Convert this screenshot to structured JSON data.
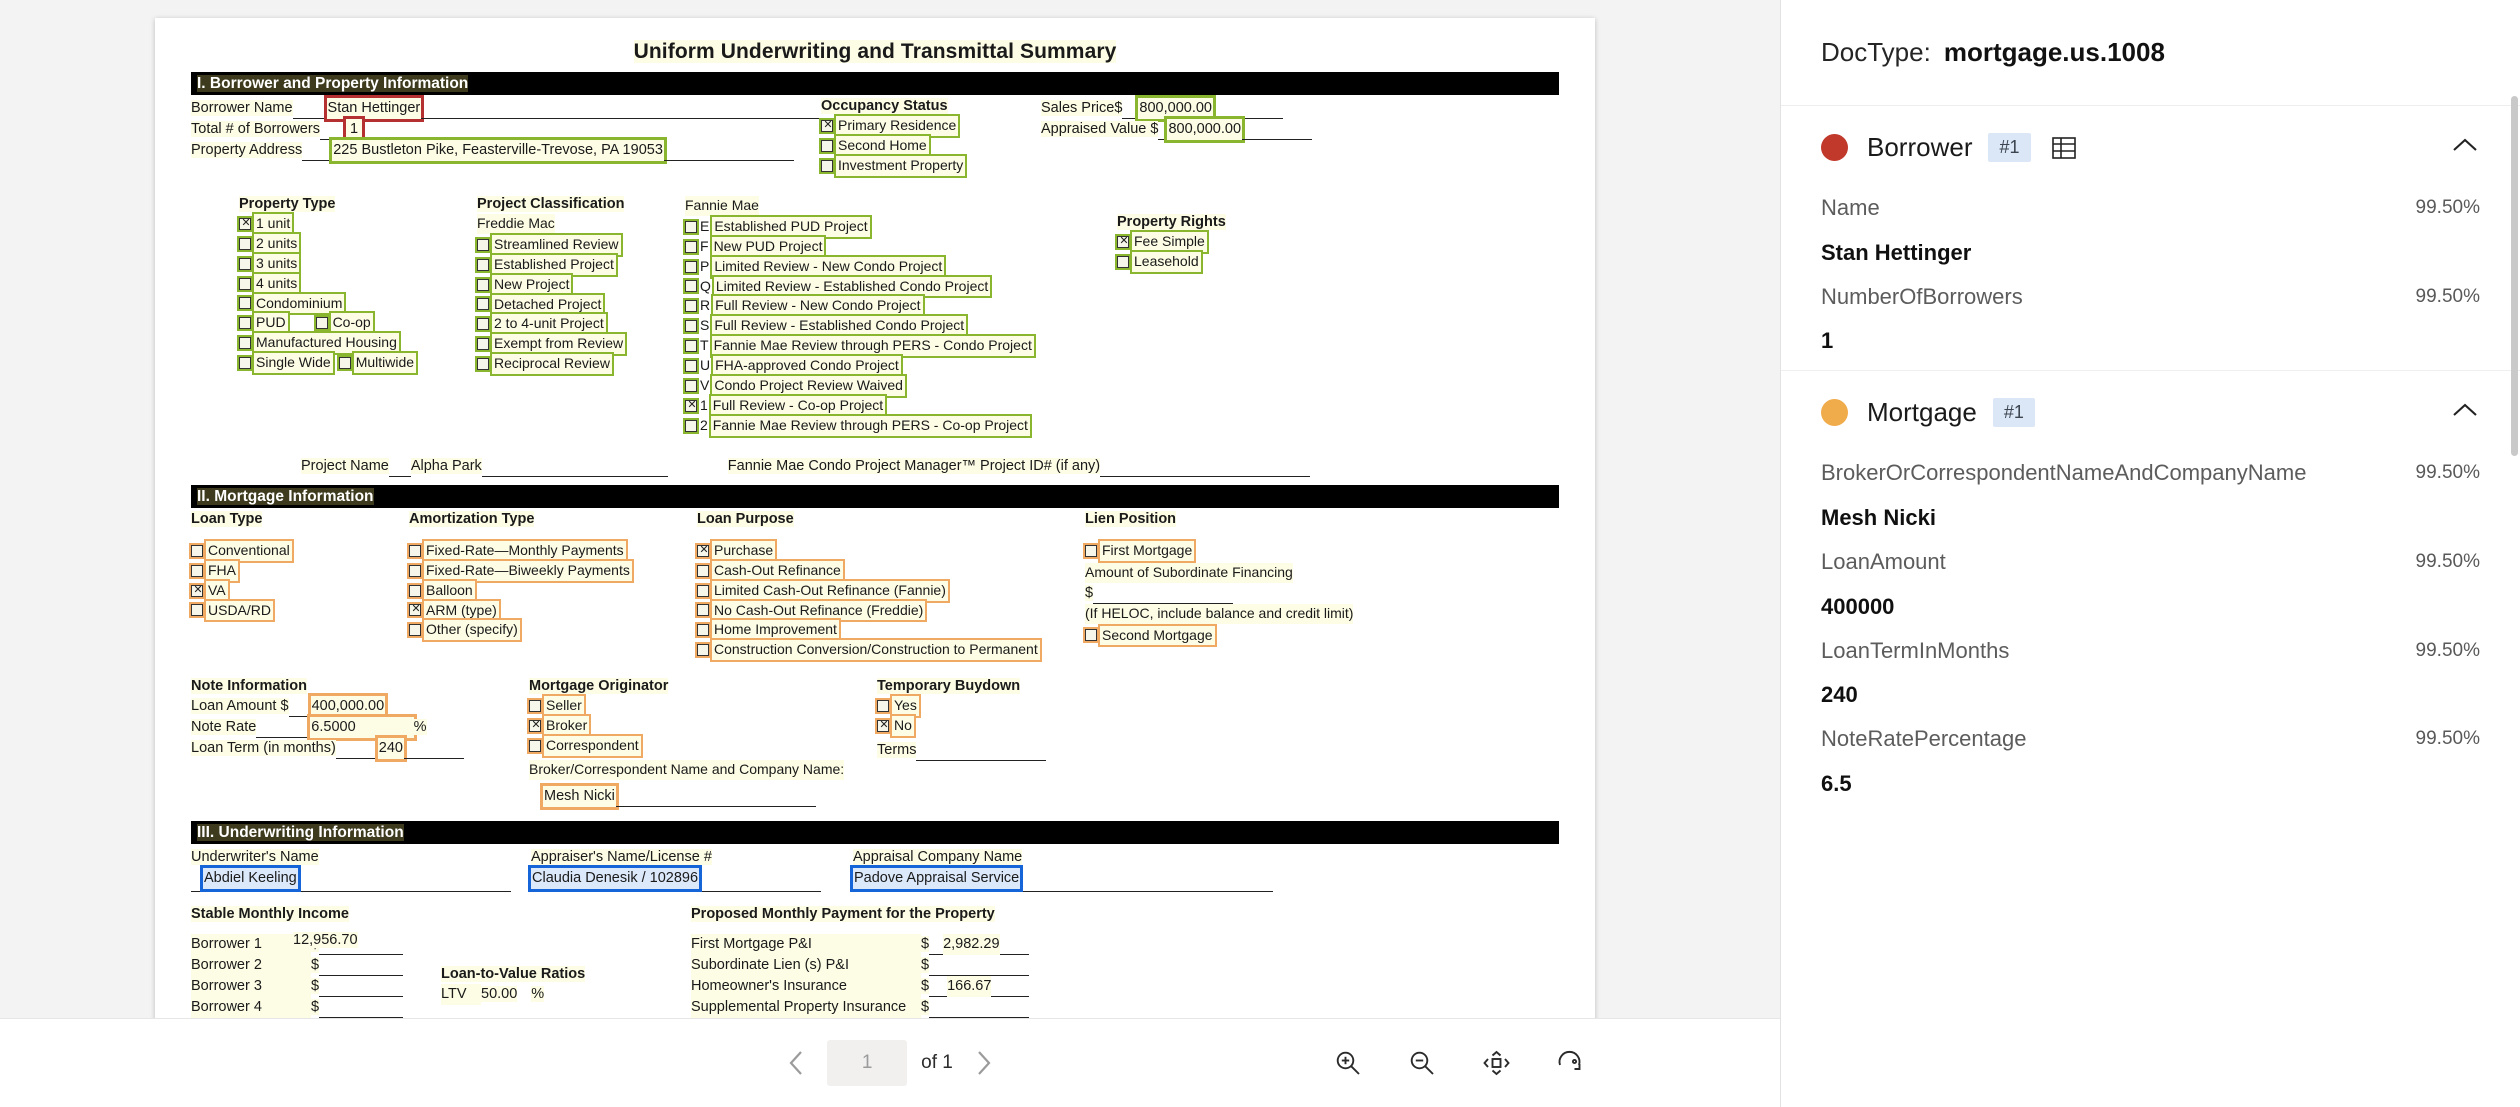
{
  "document": {
    "title": "Uniform Underwriting and Transmittal Summary",
    "section1": {
      "band": "I. Borrower and Property Information",
      "fields": [
        {
          "label": "Borrower Name",
          "value": "Stan Hettinger",
          "mark": "red"
        },
        {
          "label": "Total # of Borrowers",
          "value": "1",
          "mark": "red"
        },
        {
          "label": "Property Address",
          "value": "225 Bustleton Pike, Feasterville-Trevose, PA 19053",
          "mark": "green"
        }
      ],
      "occupancy": {
        "title": "Occupancy Status",
        "items": [
          {
            "label": "Primary Residence",
            "checked": true
          },
          {
            "label": "Second Home",
            "checked": false
          },
          {
            "label": "Investment Property",
            "checked": false
          }
        ]
      },
      "prices": [
        {
          "label": "Sales Price$",
          "value": "800,000.00"
        },
        {
          "label": "Appraised Value $",
          "value": "800,000.00"
        }
      ],
      "property_type": {
        "title": "Property Type",
        "items": [
          {
            "label": "1 unit",
            "checked": true
          },
          {
            "label": "2 units",
            "checked": false
          },
          {
            "label": "3 units",
            "checked": false
          },
          {
            "label": "4 units",
            "checked": false
          },
          {
            "label": "Condominium",
            "checked": false
          },
          {
            "label": "PUD",
            "checked": false
          },
          {
            "label": "Co-op",
            "checked": false
          },
          {
            "label": "Manufactured Housing",
            "checked": false
          },
          {
            "label": "Single Wide",
            "checked": false
          },
          {
            "label": "Multiwide",
            "checked": false
          }
        ]
      },
      "project_classification": {
        "title": "Project Classification",
        "freddie_label": "Freddie Mac",
        "freddie": [
          {
            "label": "Streamlined Review",
            "checked": false
          },
          {
            "label": "Established Project",
            "checked": false
          },
          {
            "label": "New Project",
            "checked": false
          },
          {
            "label": "Detached Project",
            "checked": false
          },
          {
            "label": "2 to 4-unit Project",
            "checked": false
          },
          {
            "label": "Exempt from Review",
            "checked": false
          },
          {
            "label": "Reciprocal Review",
            "checked": false
          }
        ],
        "fannie_label": "Fannie Mae",
        "fannie": [
          {
            "code": "E",
            "label": "Established PUD Project",
            "checked": false
          },
          {
            "code": "F",
            "label": "New PUD Project",
            "checked": false
          },
          {
            "code": "P",
            "label": "Limited Review - New Condo Project",
            "checked": false
          },
          {
            "code": "Q",
            "label": "Limited Review - Established Condo Project",
            "checked": false
          },
          {
            "code": "R",
            "label": "Full Review - New Condo Project",
            "checked": false
          },
          {
            "code": "S",
            "label": "Full Review - Established Condo Project",
            "checked": false
          },
          {
            "code": "T",
            "label": "Fannie Mae Review through PERS - Condo Project",
            "checked": false
          },
          {
            "code": "U",
            "label": "FHA-approved Condo Project",
            "checked": false
          },
          {
            "code": "V",
            "label": "Condo Project Review Waived",
            "checked": false
          },
          {
            "code": "1",
            "label": "Full Review - Co-op Project",
            "checked": true
          },
          {
            "code": "2",
            "label": "Fannie Mae Review through PERS - Co-op Project",
            "checked": false
          }
        ]
      },
      "property_rights": {
        "title": "Property Rights",
        "items": [
          {
            "label": "Fee Simple",
            "checked": true
          },
          {
            "label": "Leasehold",
            "checked": false
          }
        ]
      },
      "project_name_label": "Project Name",
      "project_name_value": "Alpha Park",
      "condo_mgr_label": "Fannie Mae Condo Project Manager™ Project ID# (if any)"
    },
    "section2": {
      "band": "II. Mortgage Information",
      "loan_type": {
        "title": "Loan Type",
        "items": [
          {
            "label": "Conventional",
            "checked": false
          },
          {
            "label": "FHA",
            "checked": false
          },
          {
            "label": "VA",
            "checked": true
          },
          {
            "label": "USDA/RD",
            "checked": false
          }
        ]
      },
      "amortization": {
        "title": "Amortization Type",
        "items": [
          {
            "label": "Fixed-Rate—Monthly Payments",
            "checked": false
          },
          {
            "label": "Fixed-Rate—Biweekly Payments",
            "checked": false
          },
          {
            "label": "Balloon",
            "checked": false
          },
          {
            "label": "ARM (type)",
            "checked": true
          },
          {
            "label": "Other (specify)",
            "checked": false
          }
        ]
      },
      "loan_purpose": {
        "title": "Loan Purpose",
        "items": [
          {
            "label": "Purchase",
            "checked": true
          },
          {
            "label": "Cash-Out Refinance",
            "checked": false
          },
          {
            "label": "Limited Cash-Out Refinance (Fannie)",
            "checked": false
          },
          {
            "label": "No Cash-Out Refinance (Freddie)",
            "checked": false
          },
          {
            "label": "Home Improvement",
            "checked": false
          },
          {
            "label": "Construction Conversion/Construction to Permanent",
            "checked": false
          }
        ]
      },
      "lien_position": {
        "title": "Lien Position",
        "items": [
          {
            "label": "First Mortgage",
            "checked": false
          },
          {
            "label": "Second Mortgage",
            "checked": false
          }
        ],
        "sub_label": "Amount of Subordinate Financing",
        "sub_dollar": "$",
        "heloc_note": "(If HELOC, include balance and credit limit)"
      },
      "note_info": {
        "title": "Note Information",
        "loan_amount_label": "Loan Amount $",
        "loan_amount_value": "400,000.00",
        "note_rate_label": "Note Rate",
        "note_rate_value": "6.5000",
        "note_rate_unit": "%",
        "loan_term_label": "Loan Term (in months)",
        "loan_term_value": "240"
      },
      "originator": {
        "title": "Mortgage Originator",
        "items": [
          {
            "label": "Seller",
            "checked": false
          },
          {
            "label": "Broker",
            "checked": true
          },
          {
            "label": "Correspondent",
            "checked": false
          }
        ],
        "company_label": "Broker/Correspondent Name and Company Name:",
        "company_value": "Mesh Nicki"
      },
      "buydown": {
        "title": "Temporary Buydown",
        "items": [
          {
            "label": "Yes",
            "checked": false
          },
          {
            "label": "No",
            "checked": true
          }
        ],
        "terms_label": "Terms"
      }
    },
    "section3": {
      "band": "III. Underwriting Information",
      "names": [
        {
          "label": "Underwriter's Name",
          "value": "Abdiel Keeling"
        },
        {
          "label": "Appraiser's Name/License #",
          "value": "Claudia Denesik / 102896"
        },
        {
          "label": "Appraisal Company Name",
          "value": "Padove Appraisal Service"
        }
      ],
      "income_title": "Stable Monthly Income",
      "income_rows": [
        {
          "label": "Borrower 1",
          "value": "12,956.70"
        },
        {
          "label": "Borrower 2",
          "value": ""
        },
        {
          "label": "Borrower 3",
          "value": ""
        },
        {
          "label": "Borrower 4",
          "value": ""
        }
      ],
      "ltv_title": "Loan-to-Value Ratios",
      "ltv_label": "LTV",
      "ltv_value": "50.00",
      "ltv_unit": "%",
      "payment_title": "Proposed Monthly Payment for the Property",
      "payment_rows": [
        {
          "label": "First Mortgage P&I",
          "value": "2,982.29"
        },
        {
          "label": "Subordinate Lien (s) P&I",
          "value": ""
        },
        {
          "label": "Homeowner's Insurance",
          "value": "166.67"
        },
        {
          "label": "Supplemental Property Insurance",
          "value": ""
        }
      ]
    }
  },
  "toolbar": {
    "prev_icon": "chevron-left-icon",
    "next_icon": "chevron-right-icon",
    "page_number": "1",
    "of_label": "of 1",
    "zoom_in_icon": "zoom-in-icon",
    "zoom_out_icon": "zoom-out-icon",
    "fit_page_icon": "fit-to-page-icon",
    "rotate_icon": "rotate-icon"
  },
  "panel": {
    "doctype_label": "DocType:",
    "doctype_value": "mortgage.us.1008",
    "groups": [
      {
        "name": "Borrower",
        "index": "#1",
        "dot_color": "#c0392b",
        "has_table_icon": true,
        "collapse_icon": "chevron-up-icon",
        "fields": [
          {
            "key": "Name",
            "confidence": "99.50%",
            "value": "Stan Hettinger"
          },
          {
            "key": "NumberOfBorrowers",
            "confidence": "99.50%",
            "value": "1"
          }
        ]
      },
      {
        "name": "Mortgage",
        "index": "#1",
        "dot_color": "#f0ab4a",
        "has_table_icon": false,
        "collapse_icon": "chevron-up-icon",
        "fields": [
          {
            "key": "BrokerOrCorrespondentNameAndCompanyName",
            "confidence": "99.50%",
            "value": "Mesh Nicki"
          },
          {
            "key": "LoanAmount",
            "confidence": "99.50%",
            "value": "400000"
          },
          {
            "key": "LoanTermInMonths",
            "confidence": "99.50%",
            "value": "240"
          },
          {
            "key": "NoteRatePercentage",
            "confidence": "99.50%",
            "value": "6.5"
          }
        ]
      }
    ]
  }
}
